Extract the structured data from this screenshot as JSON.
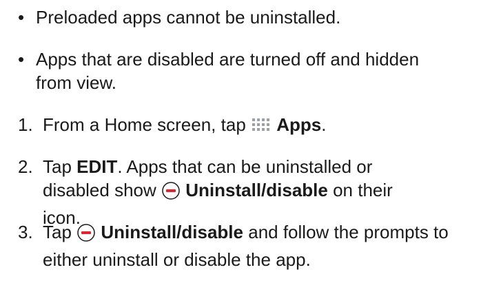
{
  "bullets": [
    {
      "marker": "•",
      "text": "Preloaded apps cannot be uninstalled."
    },
    {
      "marker": "•",
      "text": "Apps that are disabled are turned off and hidden from view."
    }
  ],
  "steps": [
    {
      "marker": "1.",
      "text_before": "From a Home screen, tap",
      "icon": "apps-grid-icon",
      "bold": "Apps",
      "text_after": "."
    },
    {
      "marker": "2.",
      "prefix": "Tap",
      "bold1": "EDIT",
      "middle": ". Apps that can be uninstalled or disabled show",
      "icon": "uninstall-disable-icon",
      "bold2": "Uninstall/disable",
      "suffix": "on their icon."
    },
    {
      "marker": "3.",
      "prefix": "Tap",
      "icon": "uninstall-disable-icon",
      "bold": "Uninstall/disable",
      "suffix": "and follow the prompts to either uninstall or disable the app."
    }
  ],
  "colors": {
    "minus_icon": "#e8202a",
    "grid_icon": "#9aa0a6",
    "text": "#1a1a1a"
  }
}
